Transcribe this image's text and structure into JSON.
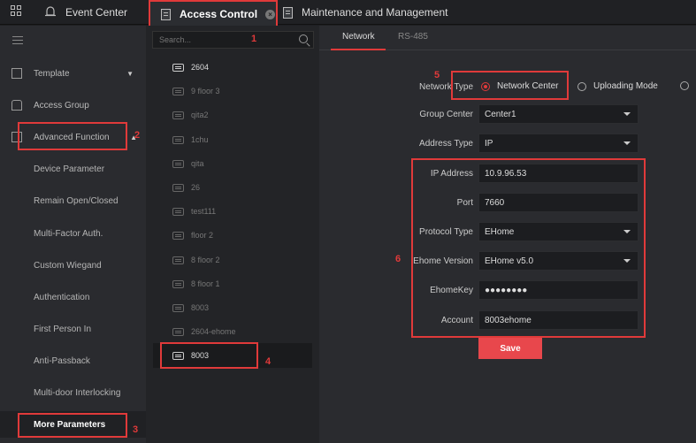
{
  "topbar": {
    "tabs": [
      {
        "label": "Event Center",
        "icon": "event-bell-icon"
      },
      {
        "label": "Access Control",
        "icon": "doc-icon",
        "active": true
      },
      {
        "label": "Maintenance and Management",
        "icon": "doc-icon"
      }
    ]
  },
  "sidebar": {
    "items": [
      {
        "label": "Template",
        "icon": "template-icon",
        "expandable": true
      },
      {
        "label": "Access Group",
        "icon": "lock-icon"
      },
      {
        "label": "Advanced Function",
        "icon": "advanced-icon",
        "expanded": true
      }
    ],
    "subitems": [
      "Device Parameter",
      "Remain Open/Closed",
      "Multi-Factor Auth.",
      "Custom Wiegand",
      "Authentication",
      "First Person In",
      "Anti-Passback",
      "Multi-door Interlocking",
      "More Parameters"
    ],
    "active_subitem": "More Parameters"
  },
  "devices": {
    "search_placeholder": "Search...",
    "items": [
      {
        "name": "2604",
        "online": true
      },
      {
        "name": "9 floor 3",
        "online": false
      },
      {
        "name": "qita2",
        "online": false
      },
      {
        "name": "1chu",
        "online": false
      },
      {
        "name": "qita",
        "online": false
      },
      {
        "name": "26",
        "online": false
      },
      {
        "name": "test111",
        "online": false
      },
      {
        "name": "floor 2",
        "online": false
      },
      {
        "name": "8 floor 2",
        "online": false
      },
      {
        "name": "8 floor 1",
        "online": false
      },
      {
        "name": "8003",
        "online": false
      },
      {
        "name": "2604-ehome",
        "online": false
      },
      {
        "name": "8003",
        "online": true,
        "selected": true
      }
    ]
  },
  "main": {
    "subtabs": [
      "Network",
      "RS-485"
    ],
    "active_subtab": "Network",
    "network_type_label": "Network Type",
    "network_type_options": [
      "Network Center",
      "Uploading Mode"
    ],
    "network_type_selected": "Network Center",
    "group_center_label": "Group Center",
    "group_center_value": "Center1",
    "address_type_label": "Address Type",
    "address_type_value": "IP",
    "ip_address_label": "IP Address",
    "ip_address_value": "10.9.96.53",
    "port_label": "Port",
    "port_value": "7660",
    "protocol_type_label": "Protocol Type",
    "protocol_type_value": "EHome",
    "ehome_version_label": "Ehome Version",
    "ehome_version_value": "EHome v5.0",
    "ehomekey_label": "EhomeKey",
    "ehomekey_value": "●●●●●●●●",
    "account_label": "Account",
    "account_value": "8003ehome",
    "save_label": "Save"
  },
  "annotations": [
    "1",
    "2",
    "3",
    "4",
    "5",
    "6"
  ],
  "colors": {
    "accent": "#e03a3a",
    "save_button": "#e8474c",
    "background": "#2a2b2f"
  }
}
